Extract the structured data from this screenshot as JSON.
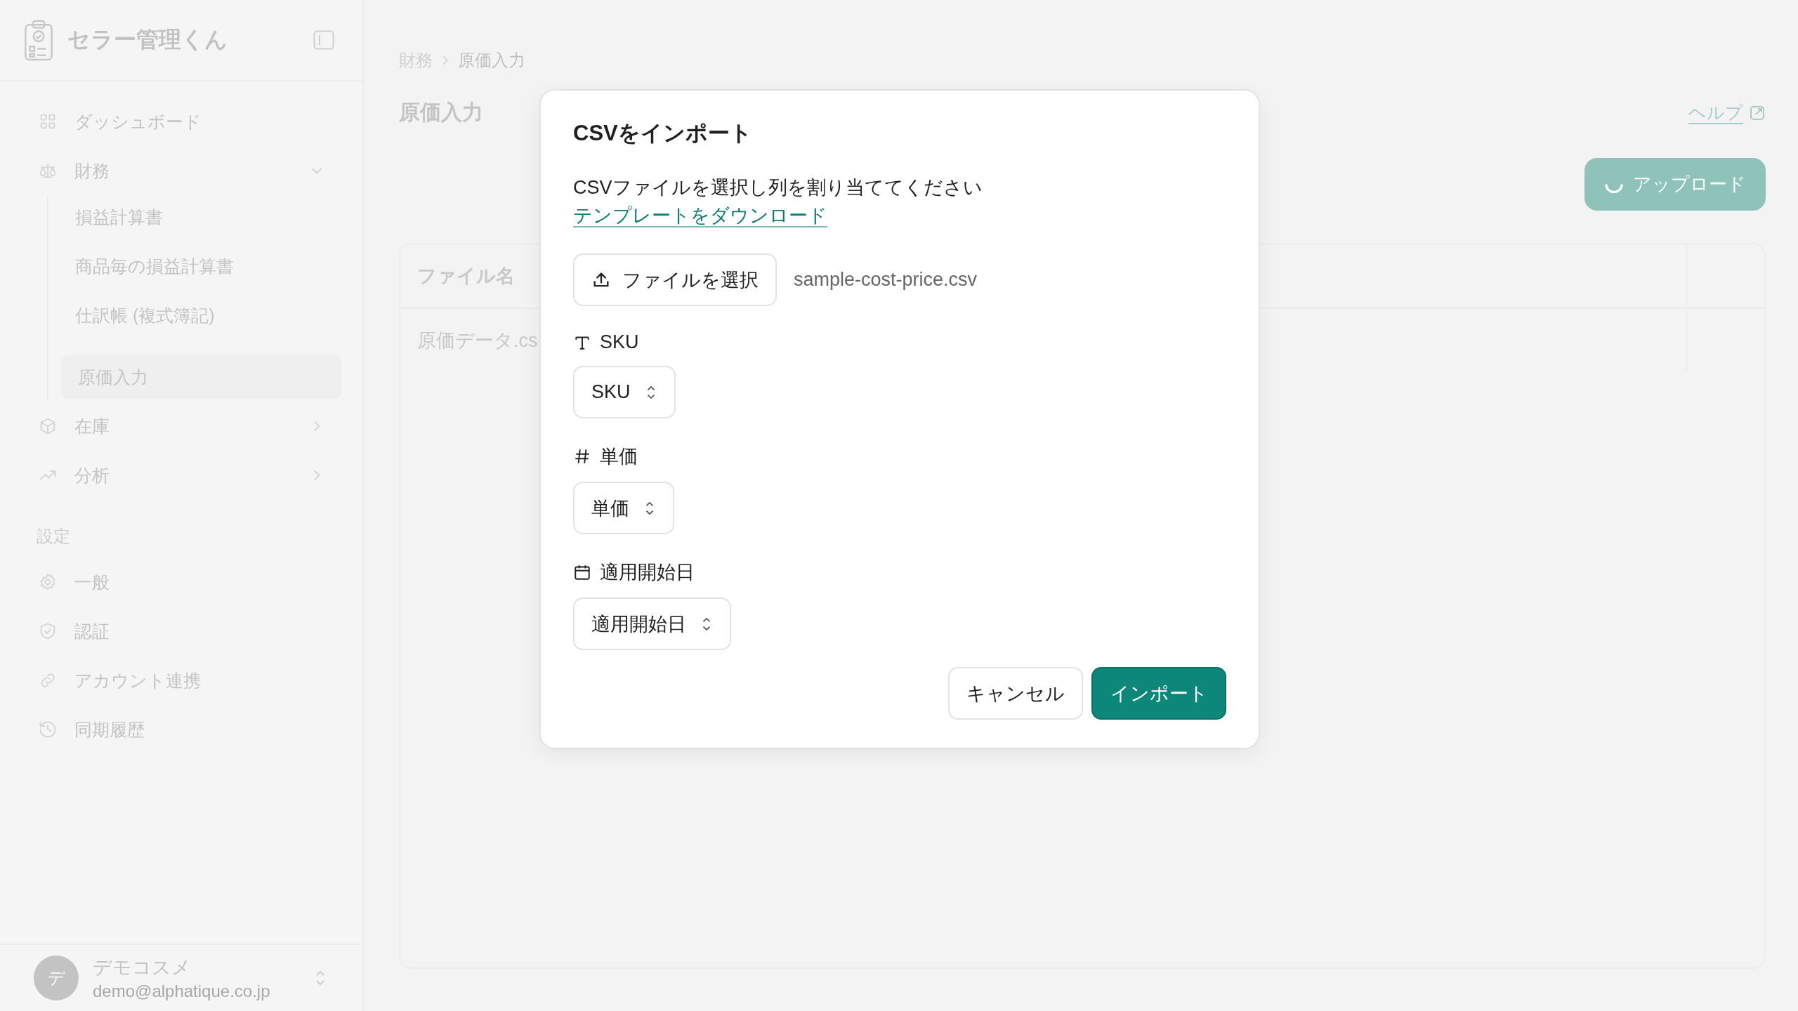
{
  "sidebar": {
    "app_name": "セラー管理くん",
    "nav": [
      {
        "label": "ダッシュボード",
        "kind": "link",
        "selected": false
      },
      {
        "label": "財務",
        "kind": "group",
        "expanded": true,
        "children": [
          {
            "label": "損益計算書",
            "selected": false
          },
          {
            "label": "商品毎の損益計算書",
            "selected": false
          },
          {
            "label": "仕訳帳 (複式簿記)",
            "selected": false
          },
          {
            "label": "原価入力",
            "selected": true
          }
        ]
      },
      {
        "label": "在庫",
        "kind": "group",
        "expanded": false
      },
      {
        "label": "分析",
        "kind": "group",
        "expanded": false
      }
    ],
    "section_label": "設定",
    "settings": [
      {
        "label": "一般",
        "selected": false
      },
      {
        "label": "認証",
        "selected": false
      },
      {
        "label": "アカウント連携",
        "selected": false
      },
      {
        "label": "同期履歴",
        "selected": false
      }
    ],
    "user": {
      "initial": "デ",
      "name": "デモコスメ",
      "email": "demo@alphatique.co.jp"
    }
  },
  "breadcrumb": [
    "財務",
    "原価入力"
  ],
  "page_title": "原価入力",
  "help_link": "ヘルプ",
  "upload_button": "アップロード",
  "table": {
    "columns": [
      "ファイル名"
    ],
    "rows": [
      [
        "原価データ.cs"
      ]
    ]
  },
  "dialog": {
    "title": "CSVをインポート",
    "description": "CSVファイルを選択し列を割り当ててください",
    "template_link": "テンプレートをダウンロード",
    "file_button": "ファイルを選択",
    "file_name": "sample-cost-price.csv",
    "mappings": [
      {
        "kind": "text",
        "label": "SKU",
        "value": "SKU"
      },
      {
        "kind": "number",
        "label": "単価",
        "value": "単価"
      },
      {
        "kind": "date",
        "label": "適用開始日",
        "value": "適用開始日"
      }
    ],
    "cancel_button": "キャンセル",
    "import_button": "インポート"
  }
}
